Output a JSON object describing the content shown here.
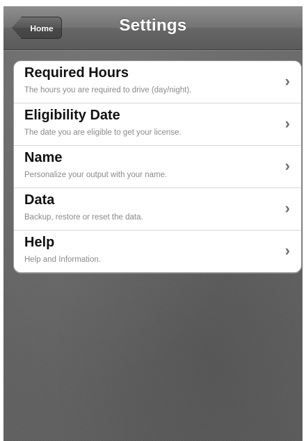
{
  "navbar": {
    "title": "Settings",
    "back_label": "Home"
  },
  "settings": {
    "items": [
      {
        "title": "Required Hours",
        "subtitle": "The hours you are required to drive (day/night).",
        "accessory": "›"
      },
      {
        "title": "Eligibility Date",
        "subtitle": "The date you are eligible to get your license.",
        "accessory": "›"
      },
      {
        "title": "Name",
        "subtitle": "Personalize your output with your name.",
        "accessory": "›"
      },
      {
        "title": "Data",
        "subtitle": "Backup, restore or reset the data.",
        "accessory": "›"
      },
      {
        "title": "Help",
        "subtitle": "Help and Information.",
        "accessory": "›"
      }
    ]
  }
}
